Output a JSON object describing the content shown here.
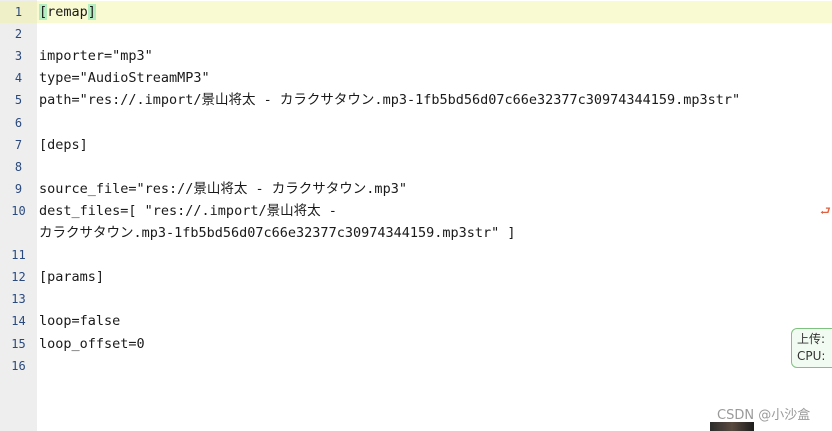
{
  "editor": {
    "lines": [
      {
        "num": "1",
        "pre": "",
        "hl": "[",
        "mid": "remap",
        "hl2": "]",
        "active": true
      },
      {
        "num": "2",
        "text": ""
      },
      {
        "num": "3",
        "text": "importer=\"mp3\""
      },
      {
        "num": "4",
        "text": "type=\"AudioStreamMP3\""
      },
      {
        "num": "5",
        "text": "path=\"res://.import/景山将太 - カラクサタウン.mp3-1fb5bd56d07c66e32377c30974344159.mp3str\""
      },
      {
        "num": "6",
        "text": ""
      },
      {
        "num": "7",
        "text": "[deps]"
      },
      {
        "num": "8",
        "text": ""
      },
      {
        "num": "9",
        "text": "source_file=\"res://景山将太 - カラクサタウン.mp3\""
      },
      {
        "num": "10",
        "text": "dest_files=[ \"res://.import/景山将太 -"
      },
      {
        "num": "",
        "text": "カラクサタウン.mp3-1fb5bd56d07c66e32377c30974344159.mp3str\" ]"
      },
      {
        "num": "11",
        "text": ""
      },
      {
        "num": "12",
        "text": "[params]"
      },
      {
        "num": "13",
        "text": ""
      },
      {
        "num": "14",
        "text": "loop=false"
      },
      {
        "num": "15",
        "text": "loop_offset=0"
      },
      {
        "num": "16",
        "text": ""
      }
    ],
    "wrap_indicator": "⮐"
  },
  "overlay": {
    "upload_label": "上传:",
    "cpu_label": "CPU:"
  },
  "watermark": "CSDN @小沙盒"
}
